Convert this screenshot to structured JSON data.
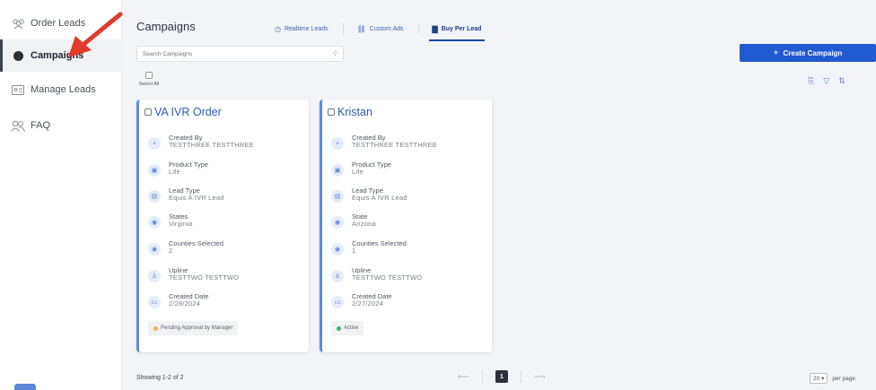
{
  "sidebar": {
    "items": [
      {
        "label": "Order Leads",
        "icon": "people-icon"
      },
      {
        "label": "Campaigns",
        "icon": "campaign-icon"
      },
      {
        "label": "Manage Leads",
        "icon": "id-card-icon"
      },
      {
        "label": "FAQ",
        "icon": "users-icon"
      }
    ],
    "active_index": 1
  },
  "header": {
    "title": "Campaigns",
    "tabs": [
      {
        "label": "Realtime Leads",
        "icon": "clock-icon"
      },
      {
        "label": "Custom Ads",
        "icon": "link-icon"
      },
      {
        "label": "Buy Per Lead",
        "icon": "square-icon"
      }
    ],
    "active_tab": 2
  },
  "search": {
    "placeholder": "Search Campaigns",
    "value": ""
  },
  "create_button": {
    "label": "Create Campaign"
  },
  "select_all": {
    "label": "Select All"
  },
  "cards": [
    {
      "title": "VA IVR Order",
      "fields": [
        {
          "label": "Created By",
          "value": "TESTTHREE TESTTHREE",
          "icon": "plus-icon"
        },
        {
          "label": "Product Type",
          "value": "Life",
          "icon": "car-icon"
        },
        {
          "label": "Lead Type",
          "value": "Equis A IVR Lead",
          "icon": "id-card-icon"
        },
        {
          "label": "States",
          "value": "Virginia",
          "icon": "location-icon"
        },
        {
          "label": "Counties Selected",
          "value": "2",
          "icon": "location-icon"
        },
        {
          "label": "Upline",
          "value": "TESTTWO TESTTWO",
          "icon": "user-icon"
        },
        {
          "label": "Created Date",
          "value": "2/28/2024",
          "icon": "calendar-icon"
        }
      ],
      "status": {
        "label": "Pending Approval by Manager",
        "color": "#f0b44c"
      }
    },
    {
      "title": "Kristan",
      "fields": [
        {
          "label": "Created By",
          "value": "TESTTHREE TESTTHREE",
          "icon": "plus-icon"
        },
        {
          "label": "Product Type",
          "value": "Life",
          "icon": "car-icon"
        },
        {
          "label": "Lead Type",
          "value": "Equis A IVR Lead",
          "icon": "id-card-icon"
        },
        {
          "label": "State",
          "value": "Arizona",
          "icon": "location-icon"
        },
        {
          "label": "Counties Selected",
          "value": "1",
          "icon": "location-icon"
        },
        {
          "label": "Upline",
          "value": "TESTTWO TESTTWO",
          "icon": "user-icon"
        },
        {
          "label": "Created Date",
          "value": "2/27/2024",
          "icon": "calendar-icon"
        }
      ],
      "status": {
        "label": "Active",
        "color": "#3fb56a"
      }
    }
  ],
  "footer": {
    "showing": "Showing 1-2 of 2",
    "current_page": "1",
    "per_page_value": "20",
    "per_page_label": "per page"
  },
  "colors": {
    "accent": "#1f5ad0",
    "card_border": "#5b8be0",
    "annotation_arrow": "#e23a2e"
  }
}
